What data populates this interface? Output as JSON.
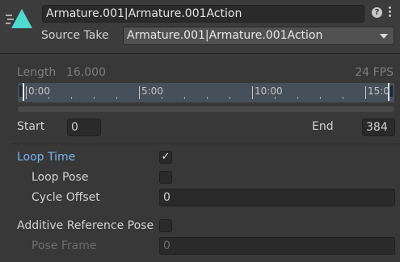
{
  "header": {
    "clip_name": "Armature.001|Armature.001Action",
    "source_take_label": "Source Take",
    "source_take_value": "Armature.001|Armature.001Action",
    "help_icon": "?"
  },
  "timeline": {
    "length_label": "Length",
    "length_value": "16.000",
    "fps_label": "24 FPS",
    "ticks": [
      "0:00",
      "5:00",
      "10:00",
      "15:0"
    ]
  },
  "range": {
    "start_label": "Start",
    "start_value": "0",
    "end_label": "End",
    "end_value": "384"
  },
  "loop": {
    "loop_time_label": "Loop Time",
    "loop_time_checked": true,
    "loop_pose_label": "Loop Pose",
    "loop_pose_checked": false,
    "cycle_offset_label": "Cycle Offset",
    "cycle_offset_value": "0"
  },
  "additive": {
    "label": "Additive Reference Pose",
    "checked": false,
    "pose_frame_label": "Pose Frame",
    "pose_frame_value": "0"
  },
  "colors": {
    "accent": "#7bb4ef",
    "clip_icon": "#4fd9d0"
  }
}
